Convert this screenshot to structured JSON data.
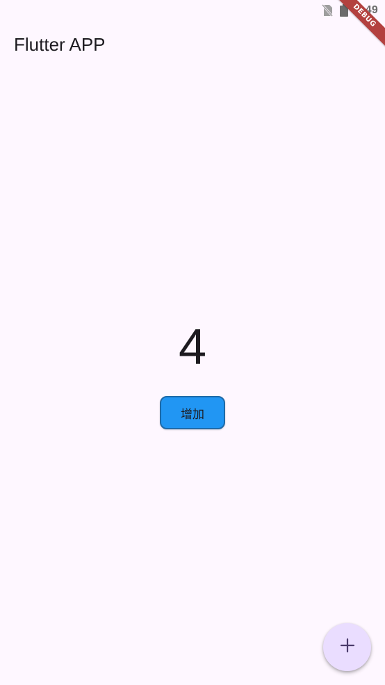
{
  "status_bar": {
    "time": "1:49",
    "icons": [
      "no-sim-icon",
      "battery-icon"
    ]
  },
  "debug_banner": {
    "label": "DEBUG",
    "color": "#b3413f"
  },
  "app_bar": {
    "title": "Flutter APP"
  },
  "counter": {
    "value": "4"
  },
  "increase_button": {
    "label": "增加",
    "color": "#2196f3",
    "border_color": "#1e6aa8"
  },
  "fab": {
    "icon": "plus-icon",
    "color": "#eaddff"
  },
  "theme": {
    "background": "#fef7ff",
    "text": "#1d1b20"
  }
}
